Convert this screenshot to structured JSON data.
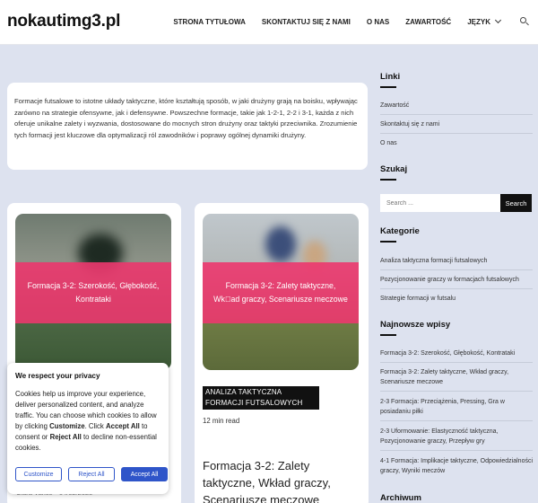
{
  "site": {
    "logo": "nokautimg3.pl"
  },
  "nav": {
    "items": [
      "STRONA TYTUŁOWA",
      "SKONTAKTUJ SIĘ Z NAMI",
      "O NAS",
      "ZAWARTOŚĆ"
    ],
    "language_label": "JĘZYK"
  },
  "intro": {
    "text": "Formacje futsalowe to istotne układy taktyczne, które kształtują sposób, w jaki drużyny grają na boisku, wpływając zarówno na strategie ofensywne, jak i defensywne. Powszechne formacje, takie jak 1-2-1, 2-2 i 3-1, każda z nich oferuje unikalne zalety i wyzwania, dostosowane do mocnych stron drużyny oraz taktyki przeciwnika. Zrozumienie tych formacji jest kluczowe dla optymalizacji ról zawodników i poprawy ogólnej dynamiki drużyny."
  },
  "posts": [
    {
      "overlay_title": "Formacja 3-2: Szerokość, Głębokość, Kontrataki",
      "author": "Clara Vance",
      "date": "04/02/2025"
    },
    {
      "overlay_title": "Formacja 3-2: Zalety taktyczne, Wk\u0000ad graczy, Scenariusze meczowe",
      "category": "ANALIZA TAKTYCZNA FORMACJI FUTSALOWYCH",
      "read_time": "12 min read",
      "title": "Formacja 3-2: Zalety taktyczne, Wkład graczy, Scenariusze meczowe"
    }
  ],
  "sidebar": {
    "links_title": "Linki",
    "links": [
      "Zawartość",
      "Skontaktuj się z nami",
      "O nas"
    ],
    "search_title": "Szukaj",
    "search_placeholder": "Search ...",
    "search_button": "Search",
    "categories_title": "Kategorie",
    "categories": [
      "Analiza taktyczna formacji futsalowych",
      "Pozycjonowanie graczy w formacjach futsalowych",
      "Strategie formacji w futsalu"
    ],
    "recent_title": "Najnowsze wpisy",
    "recent": [
      "Formacja 3-2: Szerokość, Głębokość, Kontrataki",
      "Formacja 3-2: Zalety taktyczne, Wkład graczy, Scenariusze meczowe",
      "2-3 Formacja: Przeciążenia, Pressing, Gra w posiadaniu piłki",
      "2-3 Uformowanie: Elastyczność taktyczna, Pozycjonowanie graczy, Przepływ gry",
      "4-1 Formacja: Implikacje taktyczne, Odpowiedzialności graczy, Wyniki meczów"
    ],
    "archive_title": "Archiwum"
  },
  "cookie": {
    "title": "We respect your privacy",
    "text_1": "Cookies help us improve your experience, deliver personalized content, and analyze traffic. You can choose which cookies to allow by clicking ",
    "bold_1": "Customize",
    "text_2": ". Click ",
    "bold_2": "Accept All",
    "text_3": " to consent or ",
    "bold_3": "Reject All",
    "text_4": " to decline non-essential cookies.",
    "customize_label": "Customize",
    "reject_label": "Reject All",
    "accept_label": "Accept All"
  },
  "colors": {
    "accent_pink": "#ec376e",
    "button_blue": "#2f55c9",
    "page_bg": "#dde2ef"
  }
}
